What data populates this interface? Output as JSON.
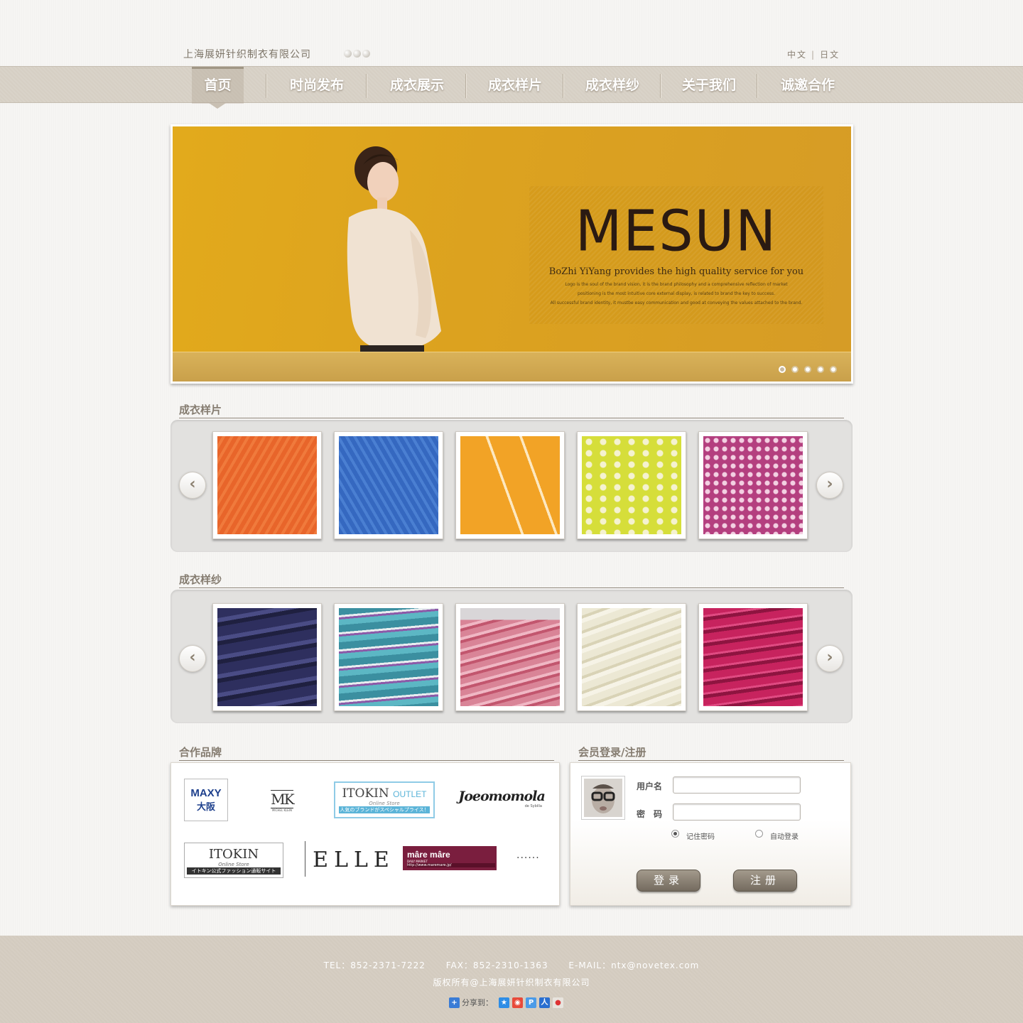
{
  "header": {
    "company": "上海展妍针织制衣有限公司",
    "lang_zh": "中文",
    "lang_sep": "|",
    "lang_ja": "日文"
  },
  "nav": {
    "items": [
      {
        "label": "首页"
      },
      {
        "label": "时尚发布"
      },
      {
        "label": "成衣展示"
      },
      {
        "label": "成衣样片"
      },
      {
        "label": "成衣样纱"
      },
      {
        "label": "关于我们"
      },
      {
        "label": "诚邀合作"
      }
    ],
    "active_index": 0
  },
  "banner": {
    "brand": "MESUN",
    "tagline": "BoZhi YiYang provides the high quality service for you",
    "desc": [
      "Logo is the soul of the brand vision, it is the brand philosophy and a comprehensive reflection of market",
      "positioning is the most intuitive core external display, is related to brand the key to success.",
      "All successful brand identity, it mustbe easy communication and good at conveying the values attached to the brand."
    ],
    "slides": 5,
    "active_slide": 1,
    "background": "#dca21f"
  },
  "samples": {
    "title": "成衣样片",
    "prev_icon": "chevron-left-icon",
    "next_icon": "chevron-right-icon",
    "swatch_colors": [
      "#e8652a",
      "#3b6ec6",
      "#f2a326",
      "#d6de3a",
      "#b43f7f"
    ]
  },
  "yarns": {
    "title": "成衣样纱",
    "swatch_colors": [
      "#3c3d6e",
      "#4aa3b0",
      "#d98497",
      "#e8e4d2",
      "#c7235e"
    ]
  },
  "brands": {
    "title": "合作品牌",
    "logos": [
      {
        "top": "MAXY",
        "bottom": "大阪"
      },
      {
        "text": "MK",
        "sub": "MICHEL KLEIN"
      },
      {
        "text": "ITOKIN",
        "badge": "OUTLET",
        "sub": "Online Store",
        "note": "人気のブランドがスペシャルプライス！"
      },
      {
        "text": "Joeomomola",
        "sub": "de Sybilla"
      },
      {
        "text": "ITOKIN",
        "sub": "Online Store",
        "note": "イトキン公式ファッション通販サイト"
      },
      {
        "text": "ELLE"
      },
      {
        "text": "mâre mâre",
        "sub": "DAILY MARKET",
        "note": "http://www.maremare.jp/"
      }
    ],
    "more": "......"
  },
  "login": {
    "title": "会员登录/注册",
    "username_label": "用户名",
    "password_label": "密　码",
    "remember_label": "记住密码",
    "auto_label": "自动登录",
    "login_button": "登录",
    "register_button": "注册"
  },
  "footer": {
    "tel": "TEL：852-2371-7222",
    "fax": "FAX：852-2310-1363",
    "email": "E-MAIL：ntx@novetex.com",
    "copyright": "版权所有@上海展妍针织制衣有限公司",
    "share": "分享到："
  }
}
